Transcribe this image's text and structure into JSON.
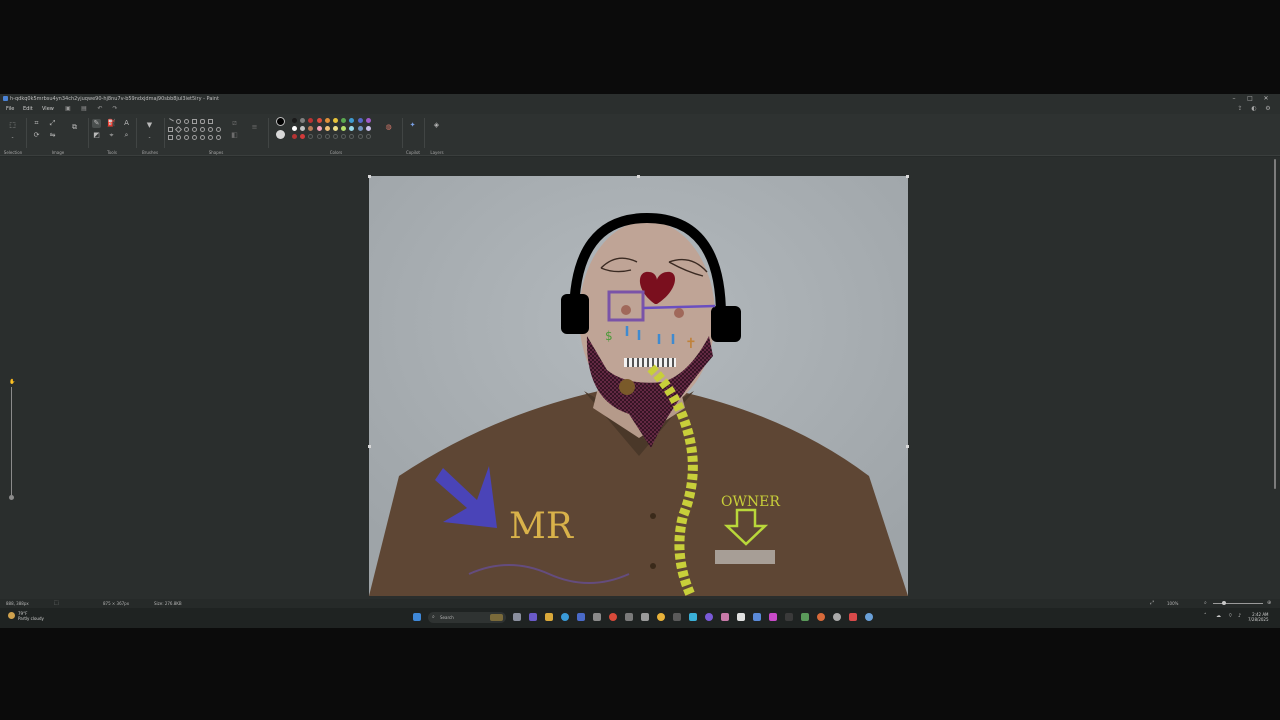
{
  "window": {
    "title": "h-qdkq0k5mrbsu4yn34ch2yjuqwe90-hj8nu7v-b59ndxjdmaj90sbb8jul3iet5iry - Paint"
  },
  "menu": {
    "items": [
      "File",
      "Edit",
      "View"
    ]
  },
  "ribbon": {
    "groups": [
      "Selection",
      "Image",
      "Tools",
      "Brushes",
      "Shapes",
      "Colors",
      "Copilot",
      "Layers"
    ]
  },
  "colors": {
    "palette_row1": [
      "#1a1a1a",
      "#7f7f7f",
      "#b83232",
      "#d94b3d",
      "#e0903a",
      "#e8c43a",
      "#5aa84f",
      "#3f9bd1",
      "#5567c7",
      "#a05ac8"
    ],
    "palette_row2": [
      "#ffffff",
      "#c3c3c3",
      "#b97a57",
      "#f5a3b8",
      "#f0c27a",
      "#eee08a",
      "#b5e06a",
      "#99d9ea",
      "#7092be",
      "#c8bfe7"
    ],
    "palette_row3": [
      "#b33434",
      "#d23a3a"
    ]
  },
  "drawing": {
    "annotation_mr": "MR",
    "annotation_owner": "OWNER",
    "annotation_dollar": "$",
    "annotation_cross": "✝"
  },
  "statusbar": {
    "cursor_pos": "888, 388px",
    "selection_size": "875 × 367px",
    "file_size": "Size: 276.8KB",
    "zoom": "100%"
  },
  "taskbar": {
    "weather_temp": "79°F",
    "weather_desc": "Partly cloudy",
    "search_placeholder": "Search",
    "time": "2:42 AM",
    "date": "7/28/2025"
  }
}
